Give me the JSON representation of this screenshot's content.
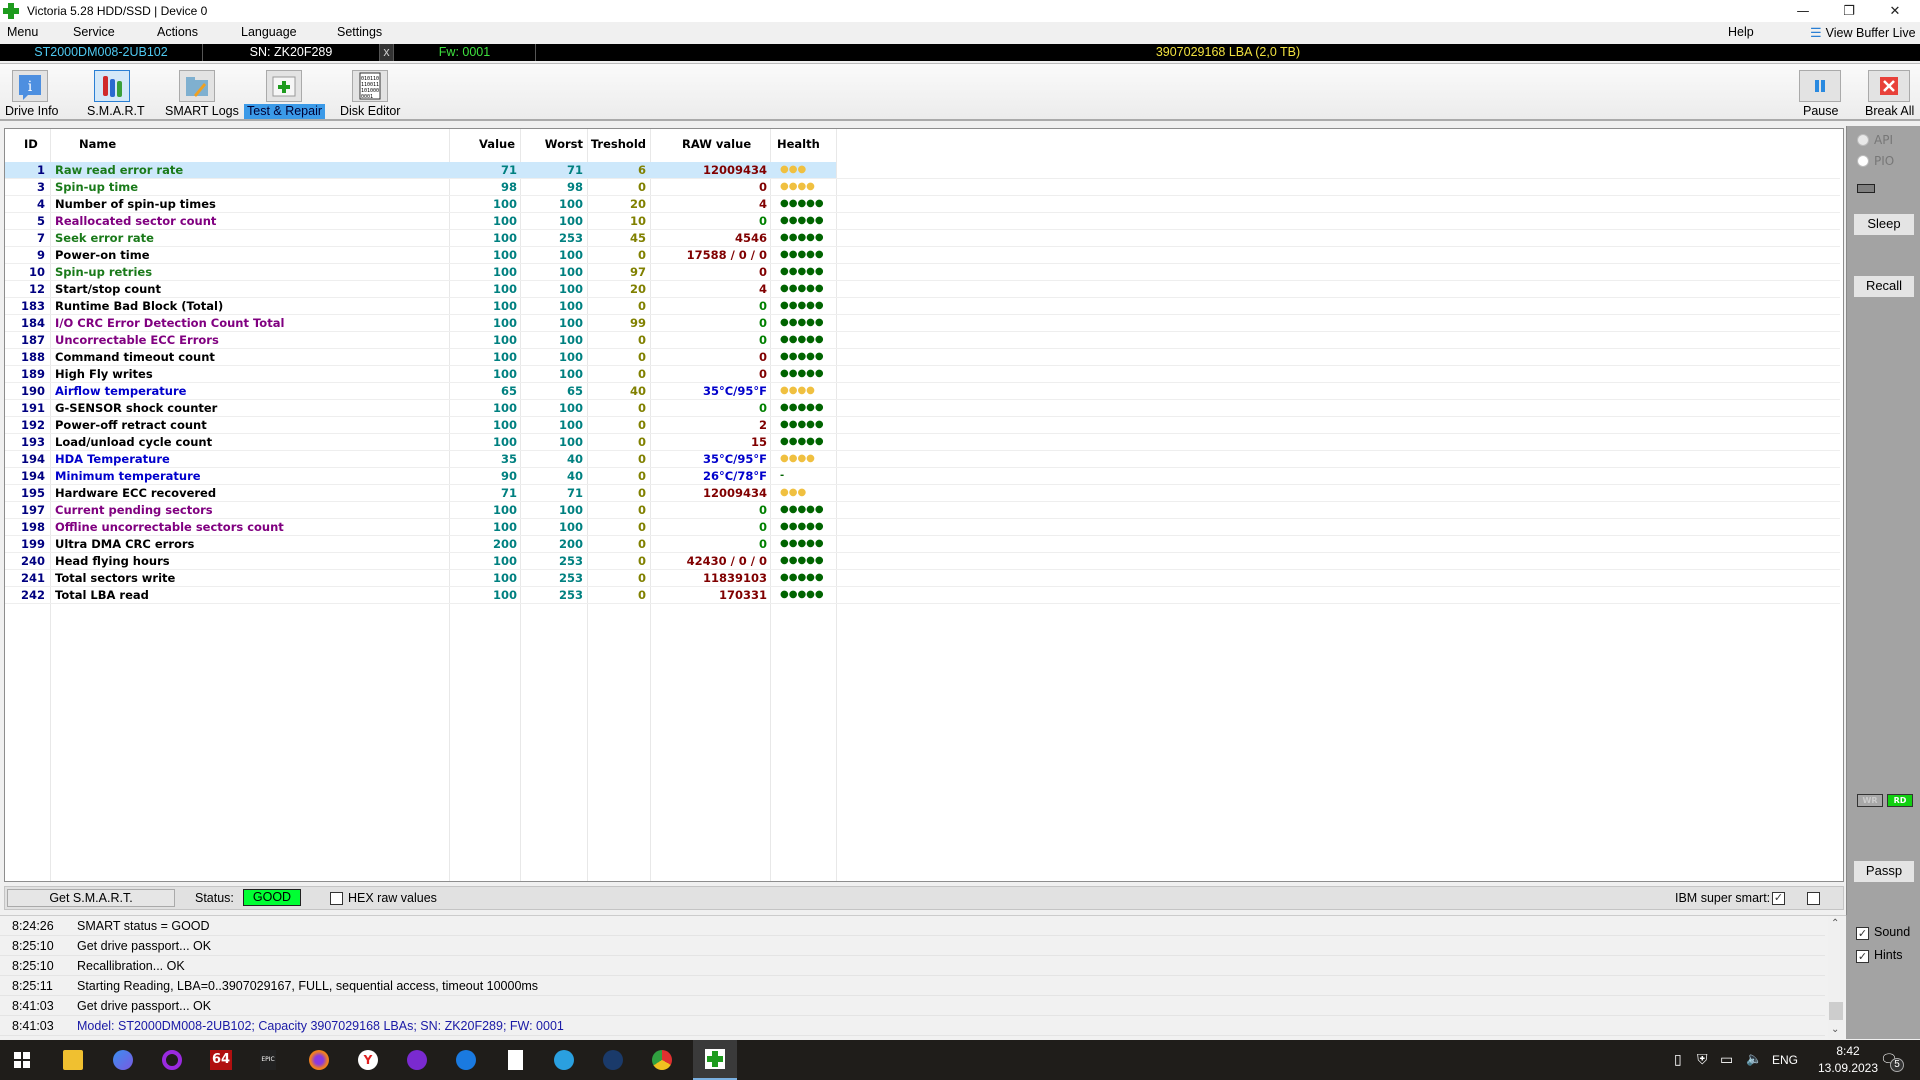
{
  "window": {
    "title": "Victoria 5.28 HDD/SSD | Device 0",
    "controls": {
      "minimize": "—",
      "restore": "❐",
      "close": "✕"
    }
  },
  "menu": {
    "items": [
      "Menu",
      "Service",
      "Actions",
      "Language",
      "Settings"
    ],
    "help": "Help",
    "view_buffer": "View Buffer Live"
  },
  "drive": {
    "model": "ST2000DM008-2UB102",
    "serial": "SN: ZK20F289",
    "close": "x",
    "firmware": "Fw: 0001",
    "capacity": "3907029168 LBA (2,0 TB)"
  },
  "toolbar": {
    "tabs": [
      {
        "label": "Drive Info",
        "icon": "info-icon"
      },
      {
        "label": "S.M.A.R.T",
        "icon": "test-tubes-icon"
      },
      {
        "label": "SMART Logs",
        "icon": "folder-edit-icon"
      },
      {
        "label": "Test & Repair",
        "icon": "first-aid-icon",
        "active": true
      },
      {
        "label": "Disk Editor",
        "icon": "binary-file-icon"
      }
    ],
    "pause": "Pause",
    "break_all": "Break All"
  },
  "table": {
    "headers": {
      "id": "ID",
      "name": "Name",
      "value": "Value",
      "worst": "Worst",
      "threshold": "Treshold",
      "raw": "RAW value",
      "health": "Health"
    },
    "colors": {
      "green": "#1a7a1a",
      "black": "#000000",
      "purple": "#800080",
      "blue": "#0000cc",
      "raw_default": "#800000",
      "raw_zero_green": "#008000",
      "raw_temp": "#0000cc",
      "health_good": "#006400",
      "health_warn": "#f0c040"
    },
    "rows": [
      {
        "id": "1",
        "name": "Raw read error rate",
        "nc": "green",
        "value": "71",
        "worst": "71",
        "threshold": "6",
        "raw": "12009434",
        "rc": "raw_default",
        "health": "●●●",
        "hc": "health_warn",
        "selected": true
      },
      {
        "id": "3",
        "name": "Spin-up time",
        "nc": "green",
        "value": "98",
        "worst": "98",
        "threshold": "0",
        "raw": "0",
        "rc": "raw_default",
        "health": "●●●●",
        "hc": "health_warn"
      },
      {
        "id": "4",
        "name": "Number of spin-up times",
        "nc": "black",
        "value": "100",
        "worst": "100",
        "threshold": "20",
        "raw": "4",
        "rc": "raw_default",
        "health": "●●●●●",
        "hc": "health_good"
      },
      {
        "id": "5",
        "name": "Reallocated sector count",
        "nc": "purple",
        "value": "100",
        "worst": "100",
        "threshold": "10",
        "raw": "0",
        "rc": "raw_zero_green",
        "health": "●●●●●",
        "hc": "health_good"
      },
      {
        "id": "7",
        "name": "Seek error rate",
        "nc": "green",
        "value": "100",
        "worst": "253",
        "threshold": "45",
        "raw": "4546",
        "rc": "raw_default",
        "health": "●●●●●",
        "hc": "health_good"
      },
      {
        "id": "9",
        "name": "Power-on time",
        "nc": "black",
        "value": "100",
        "worst": "100",
        "threshold": "0",
        "raw": "17588 / 0 / 0",
        "rc": "raw_default",
        "health": "●●●●●",
        "hc": "health_good"
      },
      {
        "id": "10",
        "name": "Spin-up retries",
        "nc": "green",
        "value": "100",
        "worst": "100",
        "threshold": "97",
        "raw": "0",
        "rc": "raw_default",
        "health": "●●●●●",
        "hc": "health_good"
      },
      {
        "id": "12",
        "name": "Start/stop count",
        "nc": "black",
        "value": "100",
        "worst": "100",
        "threshold": "20",
        "raw": "4",
        "rc": "raw_default",
        "health": "●●●●●",
        "hc": "health_good"
      },
      {
        "id": "183",
        "name": "Runtime Bad Block (Total)",
        "nc": "black",
        "value": "100",
        "worst": "100",
        "threshold": "0",
        "raw": "0",
        "rc": "raw_zero_green",
        "health": "●●●●●",
        "hc": "health_good"
      },
      {
        "id": "184",
        "name": "I/O CRC Error Detection Count Total",
        "nc": "purple",
        "value": "100",
        "worst": "100",
        "threshold": "99",
        "raw": "0",
        "rc": "raw_zero_green",
        "health": "●●●●●",
        "hc": "health_good"
      },
      {
        "id": "187",
        "name": "Uncorrectable ECC Errors",
        "nc": "purple",
        "value": "100",
        "worst": "100",
        "threshold": "0",
        "raw": "0",
        "rc": "raw_zero_green",
        "health": "●●●●●",
        "hc": "health_good"
      },
      {
        "id": "188",
        "name": "Command timeout count",
        "nc": "black",
        "value": "100",
        "worst": "100",
        "threshold": "0",
        "raw": "0",
        "rc": "raw_default",
        "health": "●●●●●",
        "hc": "health_good"
      },
      {
        "id": "189",
        "name": "High Fly writes",
        "nc": "black",
        "value": "100",
        "worst": "100",
        "threshold": "0",
        "raw": "0",
        "rc": "raw_default",
        "health": "●●●●●",
        "hc": "health_good"
      },
      {
        "id": "190",
        "name": "Airflow temperature",
        "nc": "blue",
        "value": "65",
        "worst": "65",
        "threshold": "40",
        "raw": "35°C/95°F",
        "rc": "raw_temp",
        "health": "●●●●",
        "hc": "health_warn"
      },
      {
        "id": "191",
        "name": "G-SENSOR shock counter",
        "nc": "black",
        "value": "100",
        "worst": "100",
        "threshold": "0",
        "raw": "0",
        "rc": "raw_zero_green",
        "health": "●●●●●",
        "hc": "health_good"
      },
      {
        "id": "192",
        "name": "Power-off retract count",
        "nc": "black",
        "value": "100",
        "worst": "100",
        "threshold": "0",
        "raw": "2",
        "rc": "raw_default",
        "health": "●●●●●",
        "hc": "health_good"
      },
      {
        "id": "193",
        "name": "Load/unload cycle count",
        "nc": "black",
        "value": "100",
        "worst": "100",
        "threshold": "0",
        "raw": "15",
        "rc": "raw_default",
        "health": "●●●●●",
        "hc": "health_good"
      },
      {
        "id": "194",
        "name": "HDA Temperature",
        "nc": "blue",
        "value": "35",
        "worst": "40",
        "threshold": "0",
        "raw": "35°C/95°F",
        "rc": "raw_temp",
        "health": "●●●●",
        "hc": "health_warn"
      },
      {
        "id": "194",
        "name": "Minimum temperature",
        "nc": "blue",
        "value": "90",
        "worst": "40",
        "threshold": "0",
        "raw": "26°C/78°F",
        "rc": "raw_temp",
        "health": "-",
        "hc": "health_good"
      },
      {
        "id": "195",
        "name": "Hardware ECC recovered",
        "nc": "black",
        "value": "71",
        "worst": "71",
        "threshold": "0",
        "raw": "12009434",
        "rc": "raw_default",
        "health": "●●●",
        "hc": "health_warn"
      },
      {
        "id": "197",
        "name": "Current pending sectors",
        "nc": "purple",
        "value": "100",
        "worst": "100",
        "threshold": "0",
        "raw": "0",
        "rc": "raw_zero_green",
        "health": "●●●●●",
        "hc": "health_good"
      },
      {
        "id": "198",
        "name": "Offline uncorrectable sectors count",
        "nc": "purple",
        "value": "100",
        "worst": "100",
        "threshold": "0",
        "raw": "0",
        "rc": "raw_zero_green",
        "health": "●●●●●",
        "hc": "health_good"
      },
      {
        "id": "199",
        "name": "Ultra DMA CRC errors",
        "nc": "black",
        "value": "200",
        "worst": "200",
        "threshold": "0",
        "raw": "0",
        "rc": "raw_zero_green",
        "health": "●●●●●",
        "hc": "health_good"
      },
      {
        "id": "240",
        "name": "Head flying hours",
        "nc": "black",
        "value": "100",
        "worst": "253",
        "threshold": "0",
        "raw": "42430 / 0 / 0",
        "rc": "raw_default",
        "health": "●●●●●",
        "hc": "health_good"
      },
      {
        "id": "241",
        "name": "Total sectors write",
        "nc": "black",
        "value": "100",
        "worst": "253",
        "threshold": "0",
        "raw": "11839103",
        "rc": "raw_default",
        "health": "●●●●●",
        "hc": "health_good"
      },
      {
        "id": "242",
        "name": "Total LBA read",
        "nc": "black",
        "value": "100",
        "worst": "253",
        "threshold": "0",
        "raw": "170331",
        "rc": "raw_default",
        "health": "●●●●●",
        "hc": "health_good"
      }
    ]
  },
  "status_bar": {
    "get_smart": "Get S.M.A.R.T.",
    "status_label": "Status:",
    "status_value": "GOOD",
    "hex_raw": "HEX raw values",
    "hex_checked": false,
    "ibm_super_smart": "IBM super smart:",
    "ibm_checked": true,
    "extra_checked": false
  },
  "side_panel": {
    "api": "API",
    "pio": "PIO",
    "sleep": "Sleep",
    "recall": "Recall",
    "wr": "WR",
    "rd": "RD",
    "passp": "Passp",
    "sound": "Sound",
    "sound_checked": true,
    "hints": "Hints",
    "hints_checked": true
  },
  "log": [
    {
      "time": "8:24:26",
      "msg": "SMART status = GOOD",
      "color": "#000000"
    },
    {
      "time": "8:25:10",
      "msg": "Get drive passport... OK",
      "color": "#000000"
    },
    {
      "time": "8:25:10",
      "msg": "Recallibration... OK",
      "color": "#000000"
    },
    {
      "time": "8:25:11",
      "msg": "Starting Reading, LBA=0..3907029167, FULL, sequential access, timeout 10000ms",
      "color": "#000000"
    },
    {
      "time": "8:41:03",
      "msg": "Get drive passport... OK",
      "color": "#000000"
    },
    {
      "time": "8:41:03",
      "msg": "Model: ST2000DM008-2UB102; Capacity 3907029168 LBAs; SN: ZK20F289; FW: 0001",
      "color": "#1a1aa6"
    }
  ],
  "taskbar": {
    "apps": [
      "start",
      "file-explorer",
      "bing",
      "cortana",
      "aida64",
      "epic-games",
      "firefox",
      "yandex",
      "podcast",
      "battlenet",
      "notepad",
      "telegram",
      "steam",
      "chrome",
      "victoria"
    ],
    "aida_label": "64",
    "epic_label": "EPIC",
    "lang": "ENG",
    "time": "8:42",
    "date": "13.09.2023",
    "notifications": "5"
  }
}
